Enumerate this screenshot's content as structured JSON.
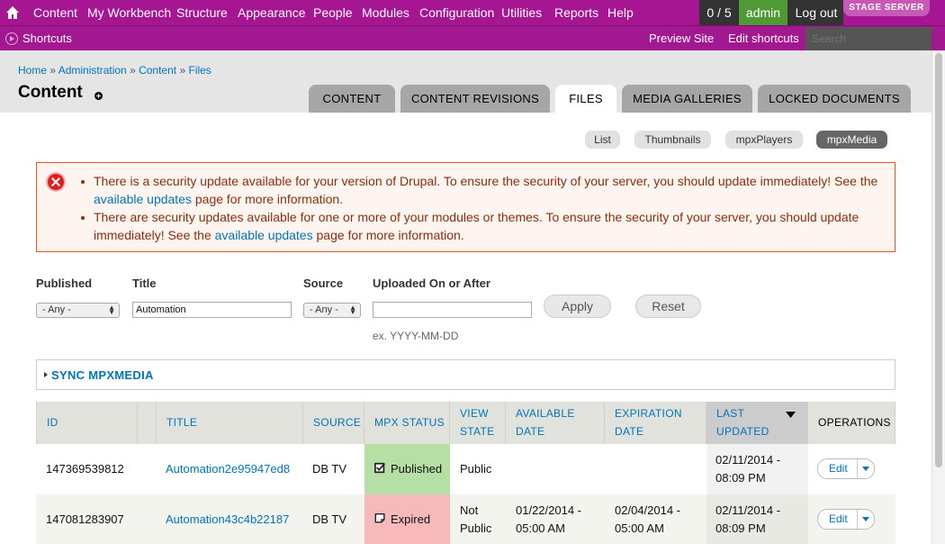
{
  "toolbar": {
    "menu": [
      "Content",
      "My Workbench",
      "Structure",
      "Appearance",
      "People",
      "Modules",
      "Configuration",
      "Utilities",
      "Reports",
      "Help"
    ],
    "counter": "0 / 5",
    "user": "admin",
    "logout": "Log out",
    "badge": "STAGE SERVER",
    "shortcuts": "Shortcuts",
    "preview": "Preview Site",
    "edit_shortcuts": "Edit shortcuts",
    "search_placeholder": "Search"
  },
  "breadcrumb": [
    "Home",
    "Administration",
    "Content",
    "Files"
  ],
  "page_title": "Content",
  "tabs": [
    "CONTENT",
    "CONTENT REVISIONS",
    "FILES",
    "MEDIA GALLERIES",
    "LOCKED DOCUMENTS"
  ],
  "active_tab": "FILES",
  "secondary_tabs": [
    "List",
    "Thumbnails",
    "mpxPlayers",
    "mpxMedia"
  ],
  "active_secondary_tab": "mpxMedia",
  "messages": [
    {
      "before": "There is a security update available for your version of Drupal. To ensure the security of your server, you should update immediately! See the ",
      "link": "available updates",
      "after": " page for more information."
    },
    {
      "before": "There are security updates available for one or more of your modules or themes. To ensure the security of your server, you should update immediately! See the ",
      "link": "available updates",
      "after": " page for more information."
    }
  ],
  "filters": {
    "published_label": "Published",
    "published_value": "- Any -",
    "title_label": "Title",
    "title_value": "Automation",
    "source_label": "Source",
    "source_value": "- Any -",
    "uploaded_label": "Uploaded On or After",
    "uploaded_value": "",
    "hint": "ex. YYYY-MM-DD",
    "apply": "Apply",
    "reset": "Reset"
  },
  "sync_fieldset": "SYNC MPXMEDIA",
  "table": {
    "headers": {
      "id": "ID",
      "title": "TITLE",
      "source": "SOURCE",
      "mpx_status": "MPX STATUS",
      "view_state_1": "VIEW",
      "view_state_2": "STATE",
      "available_1": "AVAILABLE",
      "available_2": "DATE",
      "expiration_1": "EXPIRATION",
      "expiration_2": "DATE",
      "updated_1": "LAST",
      "updated_2": "UPDATED",
      "operations": "OPERATIONS"
    },
    "rows": [
      {
        "id": "147369539812",
        "title": "Automation2e95947ed8",
        "source": "DB TV",
        "status": "Published",
        "view_1": "Public",
        "view_2": "",
        "available_1": "",
        "available_2": "",
        "expiration_1": "",
        "expiration_2": "",
        "updated_1": "02/11/2014 -",
        "updated_2": "08:09 PM",
        "op": "Edit"
      },
      {
        "id": "147081283907",
        "title": "Automation43c4b22187",
        "source": "DB TV",
        "status": "Expired",
        "view_1": "Not",
        "view_2": "Public",
        "available_1": "01/22/2014 -",
        "available_2": "05:00 AM",
        "expiration_1": "02/04/2014 -",
        "expiration_2": "05:00 AM",
        "updated_1": "02/11/2014 -",
        "updated_2": "08:09 PM",
        "op": "Edit"
      }
    ]
  },
  "colors": {
    "toolbar": "#a61592",
    "link": "#0074bd",
    "status_published": "#b6dfa5",
    "status_expired": "#f7b9b9",
    "error_border": "#ed541d"
  },
  "icons": [
    "home-icon",
    "shortcuts-icon",
    "add-shortcut-icon",
    "error-icon",
    "sort-desc-icon",
    "published-checkbox-icon",
    "expired-icon",
    "dropdown-caret-icon"
  ]
}
